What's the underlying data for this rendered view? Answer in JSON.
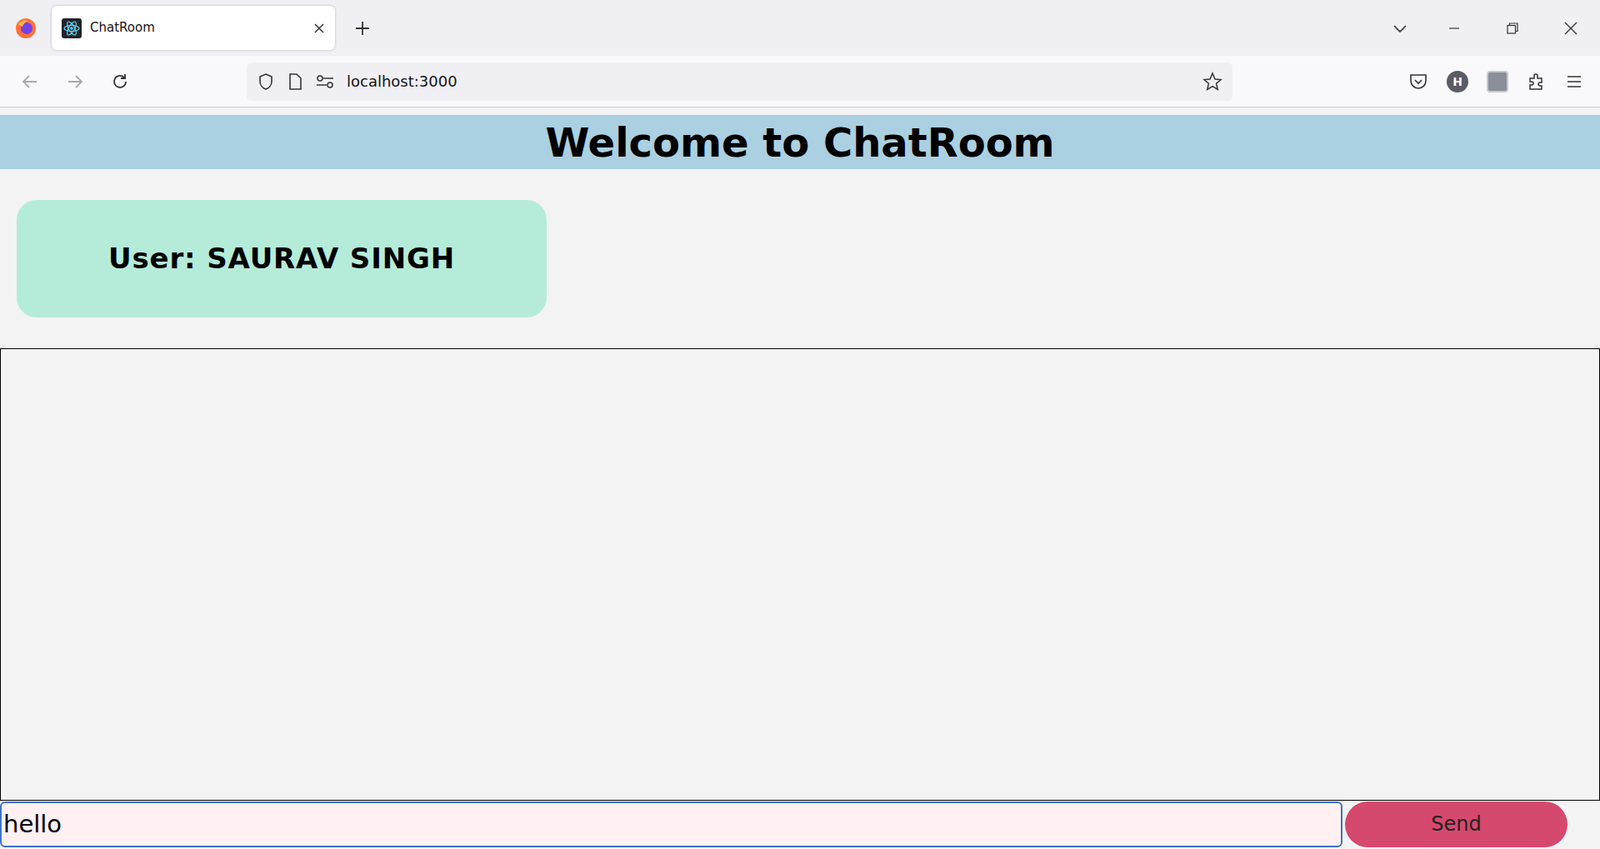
{
  "window": {
    "title": "ChatRoom"
  },
  "browser": {
    "tabs": [
      {
        "label": "ChatRoom",
        "selected": true
      }
    ],
    "url": "localhost:3000",
    "profile_initial": "H"
  },
  "page": {
    "heading": "Welcome to ChatRoom",
    "user_label": "User: SAURAV SINGH"
  },
  "composer": {
    "input_value": "hello",
    "send_button": "Send"
  }
}
